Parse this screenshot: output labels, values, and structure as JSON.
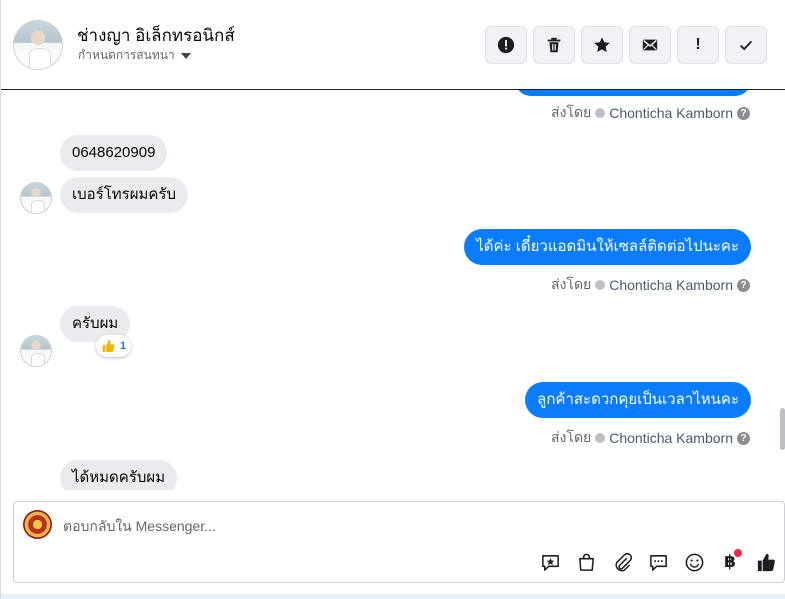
{
  "header": {
    "contact_name": "ช่างญา อิเล็กทรอนิกส์",
    "sub_label": "กำหนดการสนทนา",
    "actions": {
      "spam": "!",
      "delete": "trash",
      "star": "star",
      "mail": "mail",
      "alert": "!",
      "done": "check"
    }
  },
  "messages": [
    {
      "id": "m1",
      "direction": "in",
      "text": "0648620909"
    },
    {
      "id": "m2",
      "direction": "in",
      "text": "เบอร์โทรผมครับ"
    },
    {
      "id": "m3",
      "direction": "out",
      "text": "ได้ค่ะ เดี๋ยวแอดมินให้เซลล์ติดต่อไปนะคะ"
    },
    {
      "id": "m4",
      "direction": "in",
      "text": "ครับผม",
      "reaction": {
        "emoji": "thumbs-up",
        "count": "1"
      }
    },
    {
      "id": "m5",
      "direction": "out",
      "text": "ลูกค้าสะดวกคุยเป็นเวลาไหนคะ"
    },
    {
      "id": "m6",
      "direction": "in",
      "text": "ได้หมดครับผม"
    }
  ],
  "sent_by": {
    "prefix": "ส่งโดย",
    "agent": "Chonticha Kamborn",
    "help": "?"
  },
  "composer": {
    "placeholder": "ตอบกลับใน Messenger...",
    "currency_glyph": "฿"
  },
  "colors": {
    "outgoing_bubble": "#0a7cff",
    "incoming_bubble": "#e9ebee",
    "badge": "#f02849"
  }
}
